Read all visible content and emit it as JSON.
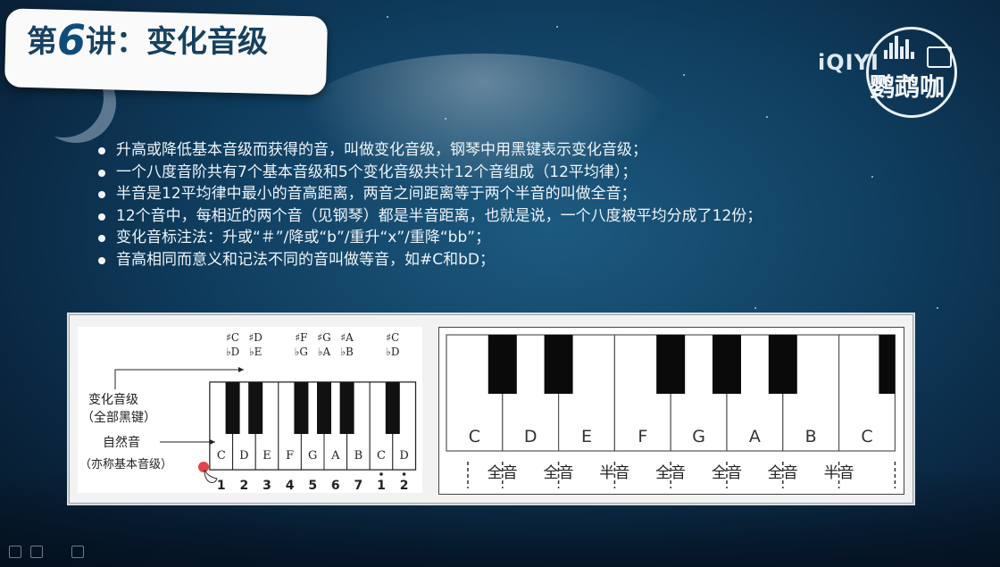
{
  "slide": {
    "title_prefix": "第",
    "title_number": "6",
    "title_suffix": "讲：变化音级",
    "logo": {
      "platform": "iQIYI",
      "brand": "鹦鹉咖"
    },
    "bullets": [
      "升高或降低基本音级而获得的音，叫做变化音级，钢琴中用黑键表示变化音级；",
      "一个八度音阶共有7个基本音级和5个变化音级共计12个音组成（12平均律）；",
      "半音是12平均律中最小的音高距离，两音之间距离等于两个半音的叫做全音；",
      "12个音中，每相近的两个音（见钢琴）都是半音距离，也就是说，一个八度被平均分成了12份；",
      "变化音标注法：升或“＃”/降或“b”/重升“x”/重降“bb”；",
      "音高相同而意义和记法不同的音叫做等音，如#C和bD；"
    ]
  },
  "left_diagram": {
    "label_altered": "变化音级",
    "label_altered_sub": "（全部黑键）",
    "label_natural": "自然音",
    "label_natural_sub": "（亦称基本音级）",
    "accidental_pairs": [
      {
        "sharp": "♯C",
        "flat": "♭D"
      },
      {
        "sharp": "♯D",
        "flat": "♭E"
      },
      {
        "sharp": "♯F",
        "flat": "♭G"
      },
      {
        "sharp": "♯G",
        "flat": "♭A"
      },
      {
        "sharp": "♯A",
        "flat": "♭B"
      },
      {
        "sharp": "♯C",
        "flat": "♭D"
      }
    ],
    "white_keys": [
      "C",
      "D",
      "E",
      "F",
      "G",
      "A",
      "B",
      "C",
      "D"
    ],
    "numbers": [
      "1",
      "2",
      "3",
      "4",
      "5",
      "6",
      "7",
      "1",
      "2"
    ],
    "number_dots": [
      false,
      false,
      false,
      false,
      false,
      false,
      false,
      true,
      true
    ]
  },
  "right_diagram": {
    "white_keys": [
      "C",
      "D",
      "E",
      "F",
      "G",
      "A",
      "B",
      "C"
    ],
    "intervals": [
      "全音",
      "全音",
      "半音",
      "全音",
      "全音",
      "全音",
      "半音"
    ]
  },
  "colors": {
    "title_text": "#17415f",
    "bullet_text": "#eef4f9",
    "key_black": "#111111",
    "key_white": "#ffffff",
    "highlight_dot": "#e0454d"
  },
  "icons": [
    "circle-bullet-icon",
    "sound-wave-icon",
    "camera-icon",
    "pointer-hand-icon",
    "pen-icon",
    "eraser-icon"
  ]
}
